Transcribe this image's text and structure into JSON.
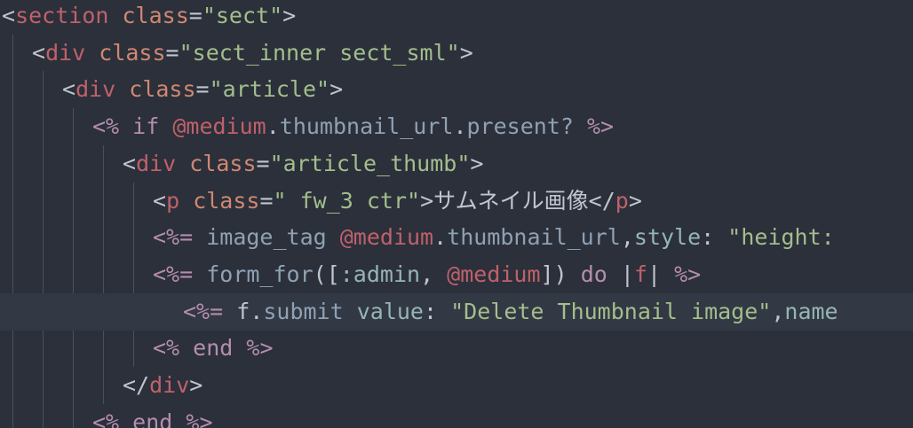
{
  "colors": {
    "background": "#2b303b",
    "active_line": "#323844",
    "tag": "#bf616a",
    "attribute": "#d08770",
    "string": "#a3be8c",
    "erb": "#b48ead",
    "method": "#8fa1b3",
    "symbol": "#96b5b4",
    "text": "#c0c5ce"
  },
  "lines": [
    {
      "active": false,
      "tokens": [
        {
          "t": "punct",
          "v": "<"
        },
        {
          "t": "tag",
          "v": "section"
        },
        {
          "t": "text",
          "v": " "
        },
        {
          "t": "attr",
          "v": "class"
        },
        {
          "t": "punct",
          "v": "="
        },
        {
          "t": "str",
          "v": "\"sect\""
        },
        {
          "t": "punct",
          "v": ">"
        }
      ]
    },
    {
      "active": false,
      "tokens": [
        {
          "t": "punct",
          "v": "<"
        },
        {
          "t": "tag",
          "v": "div"
        },
        {
          "t": "text",
          "v": " "
        },
        {
          "t": "attr",
          "v": "class"
        },
        {
          "t": "punct",
          "v": "="
        },
        {
          "t": "str",
          "v": "\"sect_inner sect_sml\""
        },
        {
          "t": "punct",
          "v": ">"
        }
      ]
    },
    {
      "active": false,
      "tokens": [
        {
          "t": "punct",
          "v": "<"
        },
        {
          "t": "tag",
          "v": "div"
        },
        {
          "t": "text",
          "v": " "
        },
        {
          "t": "attr",
          "v": "class"
        },
        {
          "t": "punct",
          "v": "="
        },
        {
          "t": "str",
          "v": "\"article\""
        },
        {
          "t": "punct",
          "v": ">"
        }
      ]
    },
    {
      "active": false,
      "tokens": [
        {
          "t": "erb",
          "v": "<%"
        },
        {
          "t": "text",
          "v": " "
        },
        {
          "t": "kw",
          "v": "if"
        },
        {
          "t": "text",
          "v": " "
        },
        {
          "t": "ivar",
          "v": "@medium"
        },
        {
          "t": "punct",
          "v": "."
        },
        {
          "t": "meth",
          "v": "thumbnail_url"
        },
        {
          "t": "punct",
          "v": "."
        },
        {
          "t": "meth",
          "v": "present?"
        },
        {
          "t": "text",
          "v": " "
        },
        {
          "t": "erb",
          "v": "%>"
        }
      ]
    },
    {
      "active": false,
      "tokens": [
        {
          "t": "punct",
          "v": "<"
        },
        {
          "t": "tag",
          "v": "div"
        },
        {
          "t": "text",
          "v": " "
        },
        {
          "t": "attr",
          "v": "class"
        },
        {
          "t": "punct",
          "v": "="
        },
        {
          "t": "str",
          "v": "\"article_thumb\""
        },
        {
          "t": "punct",
          "v": ">"
        }
      ]
    },
    {
      "active": false,
      "tokens": [
        {
          "t": "punct",
          "v": "<"
        },
        {
          "t": "tag",
          "v": "p"
        },
        {
          "t": "text",
          "v": " "
        },
        {
          "t": "attr",
          "v": "class"
        },
        {
          "t": "punct",
          "v": "="
        },
        {
          "t": "str",
          "v": "\" fw_3 ctr\""
        },
        {
          "t": "punct",
          "v": ">"
        },
        {
          "t": "text",
          "v": "サムネイル画像"
        },
        {
          "t": "punct",
          "v": "</"
        },
        {
          "t": "tag",
          "v": "p"
        },
        {
          "t": "punct",
          "v": ">"
        }
      ]
    },
    {
      "active": false,
      "tokens": [
        {
          "t": "erb",
          "v": "<%="
        },
        {
          "t": "text",
          "v": " "
        },
        {
          "t": "meth",
          "v": "image_tag"
        },
        {
          "t": "text",
          "v": " "
        },
        {
          "t": "ivar",
          "v": "@medium"
        },
        {
          "t": "punct",
          "v": "."
        },
        {
          "t": "meth",
          "v": "thumbnail_url"
        },
        {
          "t": "punct",
          "v": ","
        },
        {
          "t": "key",
          "v": "style"
        },
        {
          "t": "punct",
          "v": ":"
        },
        {
          "t": "text",
          "v": " "
        },
        {
          "t": "str",
          "v": "\"height:"
        }
      ]
    },
    {
      "active": false,
      "tokens": [
        {
          "t": "erb",
          "v": "<%="
        },
        {
          "t": "text",
          "v": " "
        },
        {
          "t": "meth",
          "v": "form_for"
        },
        {
          "t": "punct",
          "v": "(["
        },
        {
          "t": "sym",
          "v": ":admin"
        },
        {
          "t": "punct",
          "v": ", "
        },
        {
          "t": "ivar",
          "v": "@medium"
        },
        {
          "t": "punct",
          "v": "])"
        },
        {
          "t": "text",
          "v": " "
        },
        {
          "t": "kw",
          "v": "do"
        },
        {
          "t": "text",
          "v": " "
        },
        {
          "t": "punct",
          "v": "|"
        },
        {
          "t": "ivar",
          "v": "f"
        },
        {
          "t": "punct",
          "v": "|"
        },
        {
          "t": "text",
          "v": " "
        },
        {
          "t": "erb",
          "v": "%>"
        }
      ]
    },
    {
      "active": true,
      "tokens": [
        {
          "t": "erb",
          "v": "<%="
        },
        {
          "t": "text",
          "v": " "
        },
        {
          "t": "text",
          "v": "f"
        },
        {
          "t": "punct",
          "v": "."
        },
        {
          "t": "meth",
          "v": "submit"
        },
        {
          "t": "text",
          "v": " "
        },
        {
          "t": "key",
          "v": "value"
        },
        {
          "t": "punct",
          "v": ":"
        },
        {
          "t": "text",
          "v": " "
        },
        {
          "t": "str",
          "v": "\"Delete Thumbnail image\""
        },
        {
          "t": "punct",
          "v": ","
        },
        {
          "t": "key",
          "v": "name"
        }
      ]
    },
    {
      "active": false,
      "tokens": [
        {
          "t": "erb",
          "v": "<%"
        },
        {
          "t": "text",
          "v": " "
        },
        {
          "t": "kw",
          "v": "end"
        },
        {
          "t": "text",
          "v": " "
        },
        {
          "t": "erb",
          "v": "%>"
        }
      ]
    },
    {
      "active": false,
      "tokens": [
        {
          "t": "punct",
          "v": "</"
        },
        {
          "t": "tag",
          "v": "div"
        },
        {
          "t": "punct",
          "v": ">"
        }
      ]
    },
    {
      "active": false,
      "tokens": [
        {
          "t": "erb",
          "v": "<%"
        },
        {
          "t": "text",
          "v": " "
        },
        {
          "t": "kw",
          "v": "end"
        },
        {
          "t": "text",
          "v": " "
        },
        {
          "t": "erb",
          "v": "%>"
        }
      ]
    }
  ]
}
